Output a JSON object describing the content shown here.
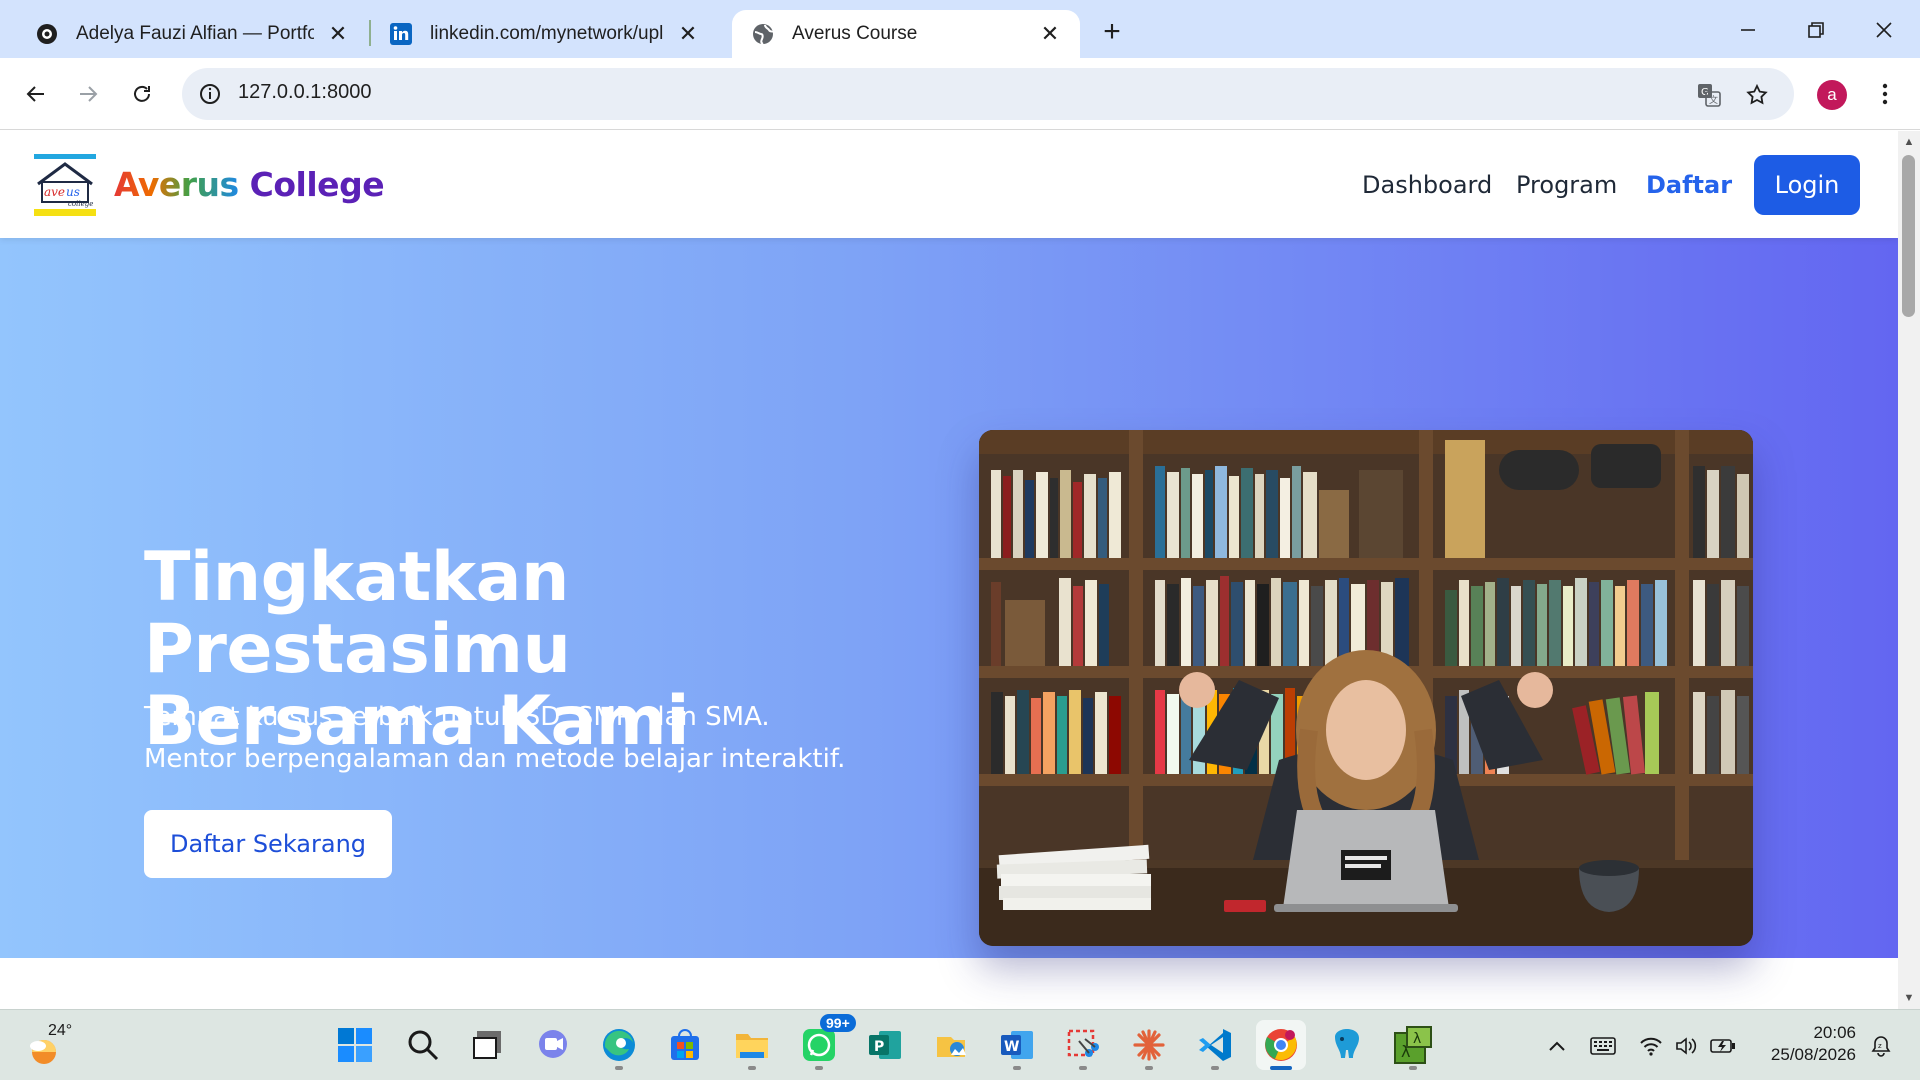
{
  "browser": {
    "tabs": [
      {
        "title": "Adelya Fauzi Alfian — Portfolio",
        "icon": "portfolio-favicon-icon"
      },
      {
        "title": "linkedin.com/mynetwork/uploa",
        "icon": "linkedin-icon"
      },
      {
        "title": "Averus Course",
        "icon": "globe-icon",
        "active": true
      }
    ],
    "url": "127.0.0.1:8000",
    "profile_initial": "a"
  },
  "site": {
    "brand_part1": "Averus",
    "brand_part2": "College",
    "nav": [
      {
        "label": "Dashboard"
      },
      {
        "label": "Program"
      },
      {
        "label": "Daftar",
        "active": true
      }
    ],
    "login_label": "Login",
    "hero": {
      "title_line1": "Tingkatkan Prestasimu",
      "title_line2": "Bersama Kami",
      "subtitle": "Tempat kursus terbaik untuk SD, SMP, dan SMA. Mentor berpengalaman dan metode belajar interaktif.",
      "cta": "Daftar Sekarang"
    }
  },
  "taskbar": {
    "temperature": "24°",
    "whatsapp_badge": "99+",
    "time": "20:06",
    "date": "25/08/2026"
  }
}
